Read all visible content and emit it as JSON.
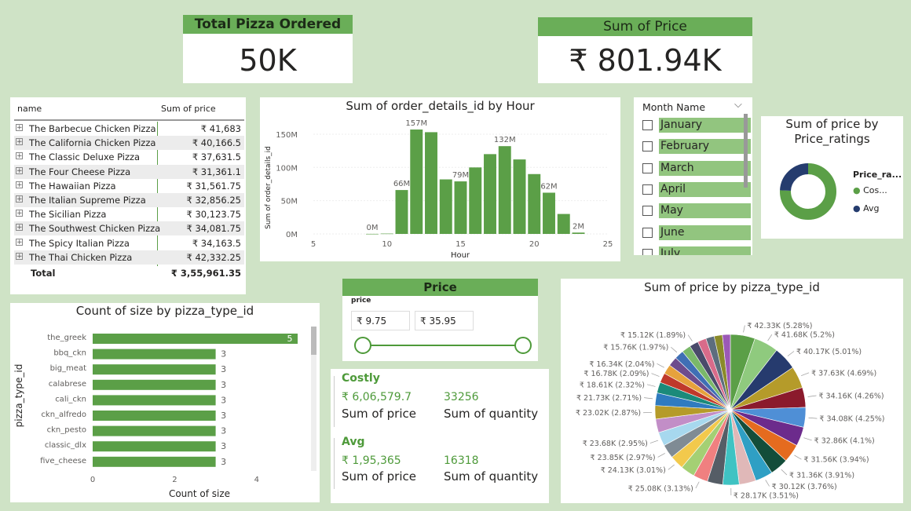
{
  "kpi_total_pizza": {
    "title": "Total Pizza Ordered",
    "value": "50K"
  },
  "kpi_sum_price": {
    "title": "Sum of Price",
    "value": "₹ 801.94K"
  },
  "matrix": {
    "col_name": "name",
    "col_price": "Sum of price",
    "rows": [
      {
        "name": "The Barbecue Chicken Pizza",
        "price": "₹ 41,683"
      },
      {
        "name": "The California Chicken Pizza",
        "price": "₹ 40,166.5"
      },
      {
        "name": "The Classic Deluxe Pizza",
        "price": "₹ 37,631.5"
      },
      {
        "name": "The Four Cheese Pizza",
        "price": "₹ 31,361.1"
      },
      {
        "name": "The Hawaiian Pizza",
        "price": "₹ 31,561.75"
      },
      {
        "name": "The Italian Supreme Pizza",
        "price": "₹ 32,856.25"
      },
      {
        "name": "The Sicilian Pizza",
        "price": "₹ 30,123.75"
      },
      {
        "name": "The Southwest Chicken Pizza",
        "price": "₹ 34,081.75"
      },
      {
        "name": "The Spicy Italian Pizza",
        "price": "₹ 34,163.5"
      },
      {
        "name": "The Thai Chicken Pizza",
        "price": "₹ 42,332.25"
      }
    ],
    "total_label": "Total",
    "total_value": "₹ 3,55,961.35"
  },
  "month_slicer": {
    "header": "Month Name",
    "items": [
      "January",
      "February",
      "March",
      "April",
      "May",
      "June",
      "July"
    ]
  },
  "price_slicer": {
    "title": "Price",
    "label": "price",
    "min": "₹ 9.75",
    "max": "₹ 35.95"
  },
  "stats": {
    "costly": {
      "title": "Costly",
      "price": "₹ 6,06,579.7",
      "qty": "33256",
      "price_label": "Sum of price",
      "qty_label": "Sum of quantity"
    },
    "avg": {
      "title": "Avg",
      "price": "₹ 1,95,365",
      "qty": "16318",
      "price_label": "Sum of price",
      "qty_label": "Sum of quantity"
    }
  },
  "colors": {
    "accent": "#5b9f47",
    "background": "#cfe3c6",
    "header": "#6aae58",
    "navy": "#253c6e"
  },
  "chart_data": [
    {
      "id": "hour",
      "type": "bar",
      "title": "Sum of order_details_id by Hour",
      "xlabel": "Hour",
      "ylabel": "Sum of order_details_id",
      "x": [
        9,
        10,
        11,
        12,
        13,
        14,
        15,
        16,
        17,
        18,
        19,
        20,
        21,
        22,
        23
      ],
      "values": [
        0.1,
        0.5,
        66,
        157,
        153,
        82,
        79,
        100,
        120,
        132,
        112,
        90,
        62,
        30,
        2
      ],
      "data_labels": [
        {
          "x": 9,
          "text": "0M"
        },
        {
          "x": 11,
          "text": "66M"
        },
        {
          "x": 12,
          "text": "157M"
        },
        {
          "x": 15,
          "text": "79M"
        },
        {
          "x": 18,
          "text": "132M"
        },
        {
          "x": 21,
          "text": "62M"
        },
        {
          "x": 23,
          "text": "2M"
        }
      ],
      "xlim": [
        5,
        25
      ],
      "ylim": [
        0,
        170
      ],
      "xticks": [
        "5",
        "10",
        "15",
        "20",
        "25"
      ],
      "yticks": [
        "0M",
        "50M",
        "100M",
        "150M"
      ]
    },
    {
      "id": "ratings",
      "type": "pie",
      "title": "Sum of price by Price_ratings",
      "legend_title": "Price_ra...",
      "series": [
        {
          "name": "Cos...",
          "value": 606579.7,
          "color": "#5b9f47"
        },
        {
          "name": "Avg",
          "value": 195365,
          "color": "#253c6e"
        }
      ]
    },
    {
      "id": "size",
      "type": "bar",
      "title": "Count of size by pizza_type_id",
      "xlabel": "Count of size",
      "ylabel": "pizza_type_id",
      "categories": [
        "the_greek",
        "bbq_ckn",
        "big_meat",
        "calabrese",
        "cali_ckn",
        "ckn_alfredo",
        "ckn_pesto",
        "classic_dlx",
        "five_cheese"
      ],
      "values": [
        5,
        3,
        3,
        3,
        3,
        3,
        3,
        3,
        3
      ],
      "xlim": [
        0,
        5
      ],
      "xticks": [
        "0",
        "2",
        "4"
      ]
    },
    {
      "id": "ptype",
      "type": "pie",
      "title": "Sum of price by pizza_type_id",
      "slices": [
        {
          "label": "₹ 42.33K (5.28%)",
          "value": 5.28,
          "color": "#5b9f47"
        },
        {
          "label": "₹ 41.68K (5.2%)",
          "value": 5.2,
          "color": "#8fca7e"
        },
        {
          "label": "₹ 40.17K (5.01%)",
          "value": 5.01,
          "color": "#263b6e"
        },
        {
          "label": "₹ 37.63K (4.69%)",
          "value": 4.69,
          "color": "#b59b2a"
        },
        {
          "label": "₹ 34.16K (4.26%)",
          "value": 4.26,
          "color": "#8b1a2c"
        },
        {
          "label": "₹ 34.08K (4.25%)",
          "value": 4.25,
          "color": "#4f8fd6"
        },
        {
          "label": "₹ 32.86K (4.1%)",
          "value": 4.1,
          "color": "#6c2b8c"
        },
        {
          "label": "₹ 31.56K (3.94%)",
          "value": 3.94,
          "color": "#e56b1f"
        },
        {
          "label": "₹ 31.36K (3.91%)",
          "value": 3.91,
          "color": "#134d3a"
        },
        {
          "label": "₹ 30.12K (3.76%)",
          "value": 3.76,
          "color": "#2f9fc4"
        },
        {
          "label": "",
          "value": 3.6,
          "color": "#e0b8b8"
        },
        {
          "label": "₹ 28.17K (3.51%)",
          "value": 3.51,
          "color": "#3fc3c3"
        },
        {
          "label": "",
          "value": 3.3,
          "color": "#555d66"
        },
        {
          "label": "₹ 25.08K (3.13%)",
          "value": 3.13,
          "color": "#f08080"
        },
        {
          "label": "",
          "value": 3.05,
          "color": "#a4d074"
        },
        {
          "label": "₹ 24.13K (3.01%)",
          "value": 3.01,
          "color": "#f2c94c"
        },
        {
          "label": "₹ 23.85K (2.97%)",
          "value": 2.97,
          "color": "#7f8b94"
        },
        {
          "label": "₹ 23.68K (2.95%)",
          "value": 2.95,
          "color": "#a7d8ee"
        },
        {
          "label": "",
          "value": 2.92,
          "color": "#c28ec7"
        },
        {
          "label": "₹ 23.02K (2.87%)",
          "value": 2.87,
          "color": "#b59b2a"
        },
        {
          "label": "₹ 21.73K (2.71%)",
          "value": 2.71,
          "color": "#2f7bbf"
        },
        {
          "label": "₹ 18.61K (2.32%)",
          "value": 2.32,
          "color": "#1b8a7a"
        },
        {
          "label": "₹ 16.78K (2.09%)",
          "value": 2.09,
          "color": "#c0392b"
        },
        {
          "label": "₹ 16.34K (2.04%)",
          "value": 2.04,
          "color": "#e6a23c"
        },
        {
          "label": "",
          "value": 2.0,
          "color": "#6d4c8d"
        },
        {
          "label": "₹ 15.76K (1.97%)",
          "value": 1.97,
          "color": "#3f6fb5"
        },
        {
          "label": "",
          "value": 1.93,
          "color": "#7ab86a"
        },
        {
          "label": "₹ 15.12K (1.89%)",
          "value": 1.89,
          "color": "#4a4a6a"
        },
        {
          "label": "",
          "value": 1.85,
          "color": "#d96b8a"
        },
        {
          "label": "",
          "value": 1.8,
          "color": "#5d6d7e"
        },
        {
          "label": "",
          "value": 1.75,
          "color": "#8a8a2a"
        },
        {
          "label": "",
          "value": 1.7,
          "color": "#9b59b6"
        }
      ]
    }
  ]
}
